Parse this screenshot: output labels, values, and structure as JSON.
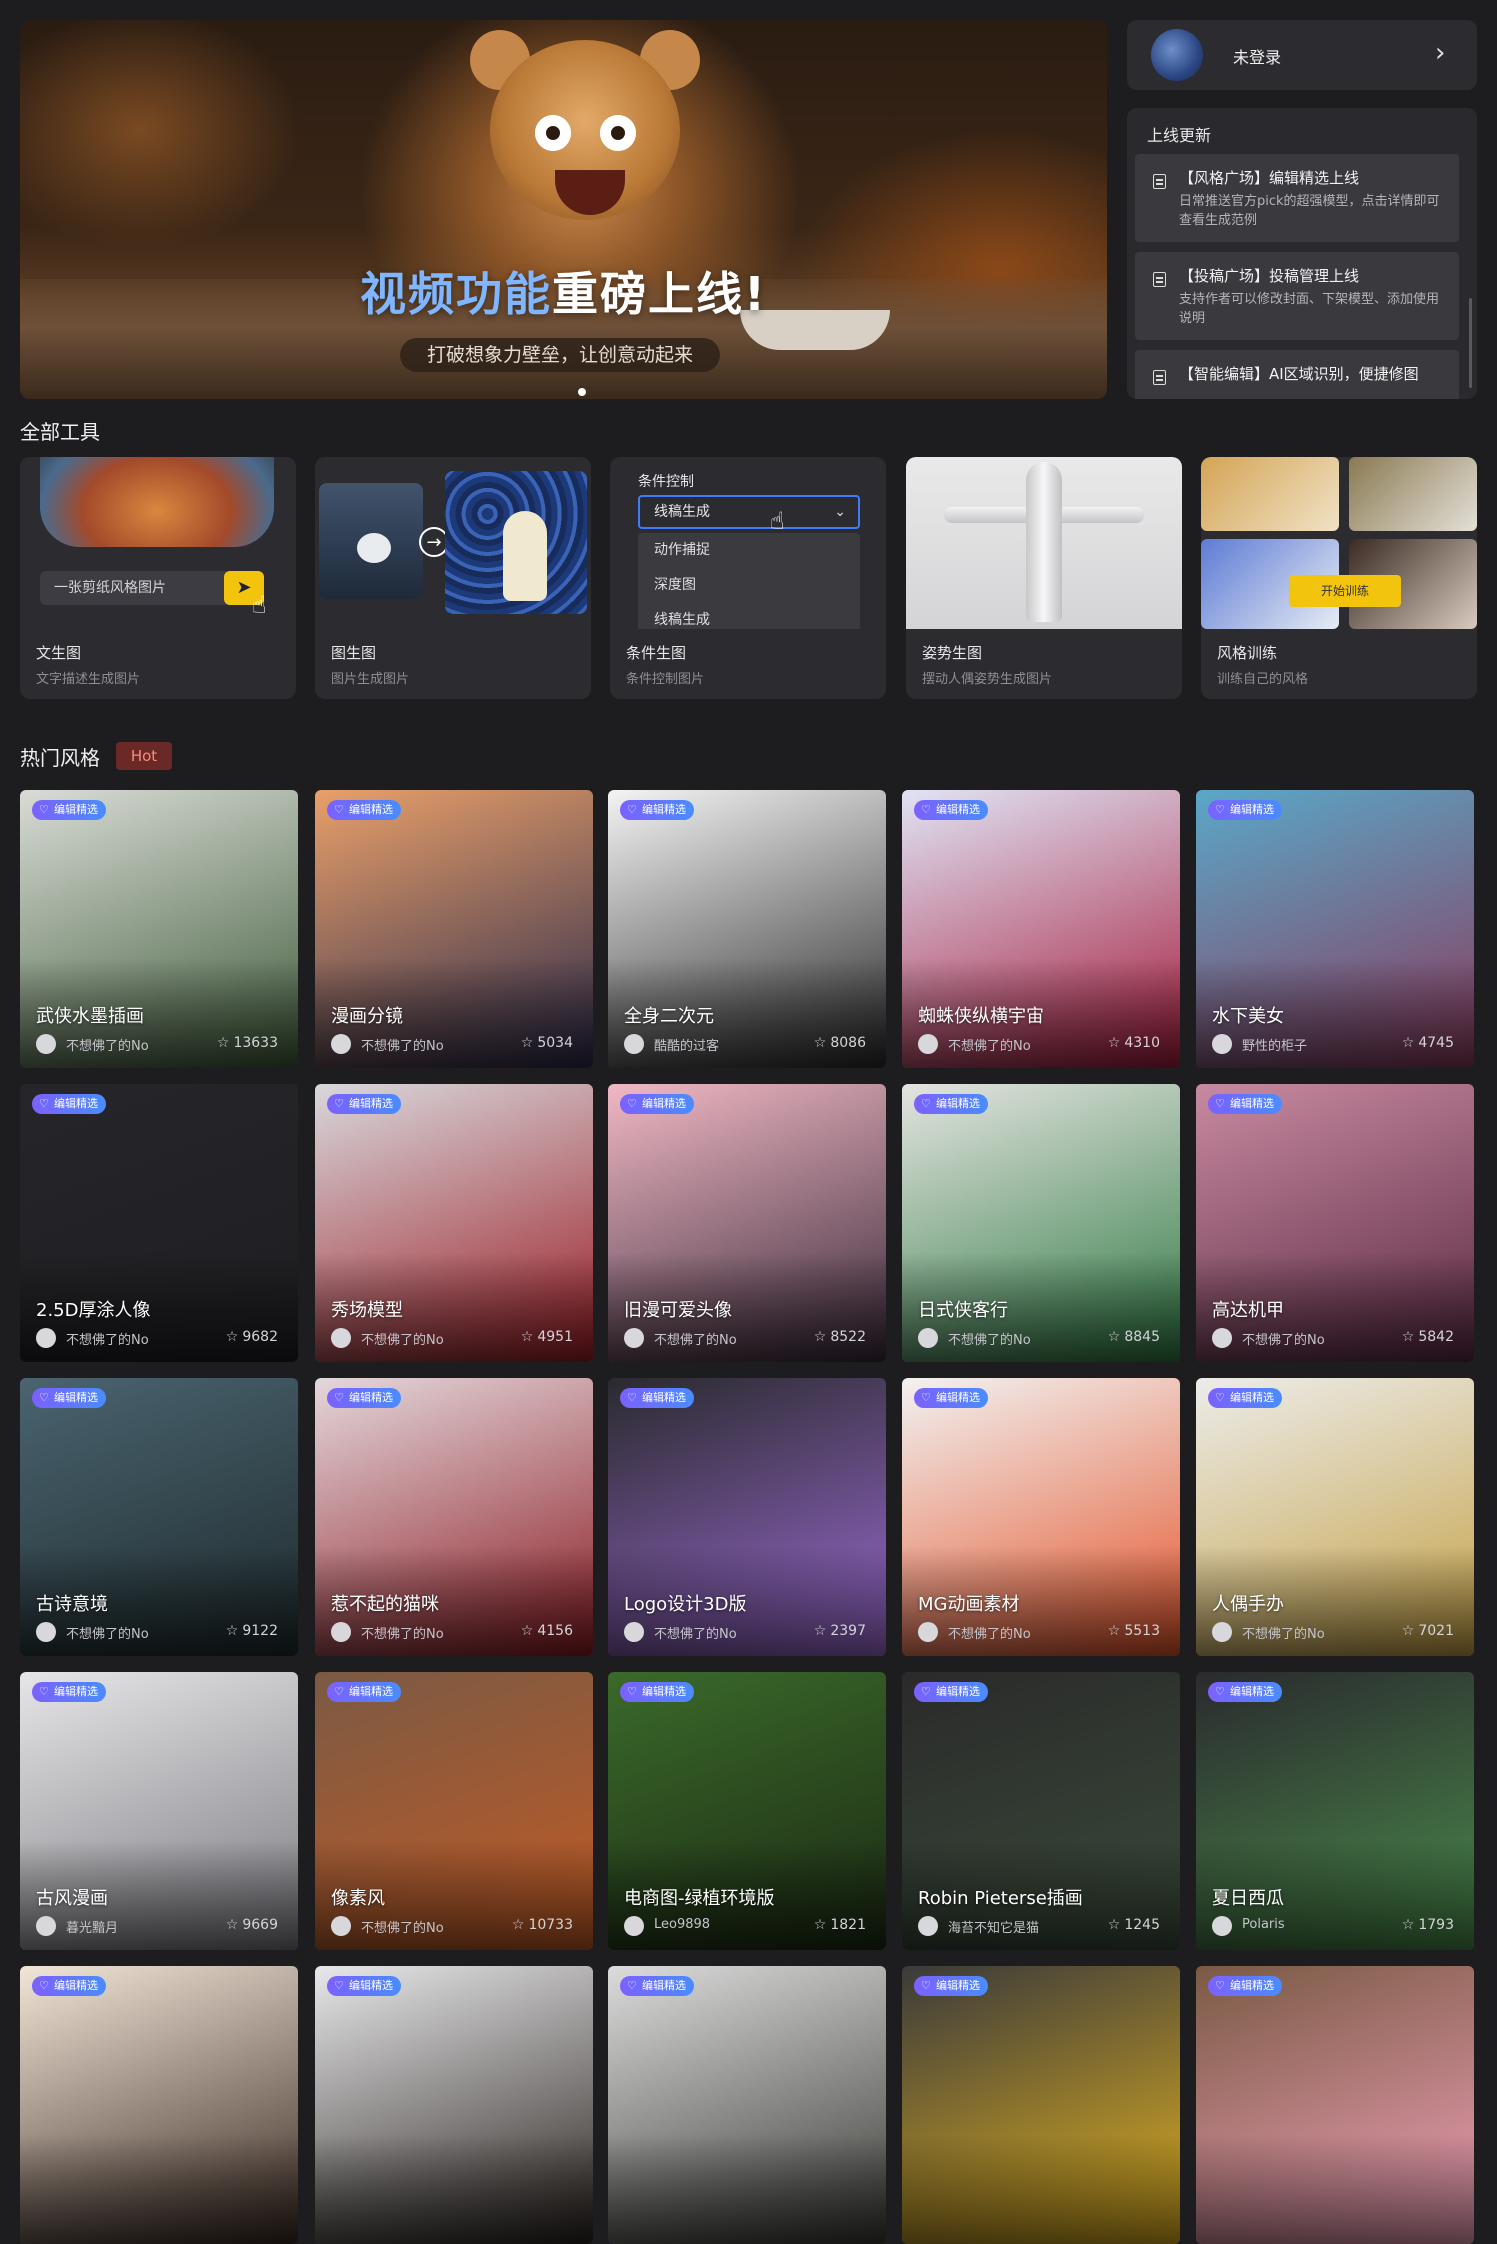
{
  "banner": {
    "headline_colored": "视频功能",
    "headline_rest": "重磅上线!",
    "subtitle": "打破想象力壁垒，让创意动起来"
  },
  "user": {
    "name": "未登录"
  },
  "updates": {
    "title": "上线更新",
    "items": [
      {
        "title": "【风格广场】编辑精选上线",
        "desc": "日常推送官方pick的超强模型，点击详情即可查看生成范例"
      },
      {
        "title": "【投稿广场】投稿管理上线",
        "desc": "支持作者可以修改封面、下架模型、添加使用说明"
      },
      {
        "title": "【智能编辑】AI区域识别，便捷修图",
        "desc": ""
      }
    ]
  },
  "tools_section": {
    "title": "全部工具",
    "tools": [
      {
        "name": "文生图",
        "desc": "文字描述生成图片",
        "prompt": "一张剪纸风格图片"
      },
      {
        "name": "图生图",
        "desc": "图片生成图片"
      },
      {
        "name": "条件生图",
        "desc": "条件控制图片",
        "label": "条件控制",
        "selected": "线稿生成",
        "options": [
          "动作捕捉",
          "深度图",
          "线稿生成"
        ]
      },
      {
        "name": "姿势生图",
        "desc": "摆动人偶姿势生成图片"
      },
      {
        "name": "风格训练",
        "desc": "训练自己的风格",
        "button": "开始训练"
      }
    ]
  },
  "hot_section": {
    "title": "热门风格",
    "badge": "Hot",
    "tag_label": "编辑精选",
    "cards": [
      {
        "title": "武侠水墨插画",
        "author": "不想佛了的No",
        "likes": "13633",
        "c1": "#d9dcd6",
        "c2": "#3f5a3a"
      },
      {
        "title": "漫画分镜",
        "author": "不想佛了的No",
        "likes": "5034",
        "c1": "#e9a06a",
        "c2": "#2c2a4a"
      },
      {
        "title": "全身二次元",
        "author": "酷酷的过客",
        "likes": "8086",
        "c1": "#f4f4f4",
        "c2": "#2a2a2a"
      },
      {
        "title": "蜘蛛侠纵横宇宙",
        "author": "不想佛了的No",
        "likes": "4310",
        "c1": "#e0e4f4",
        "c2": "#a51a3c"
      },
      {
        "title": "水下美女",
        "author": "野性的柜子",
        "likes": "4745",
        "c1": "#5aa8c8",
        "c2": "#8a3a5c"
      },
      {
        "title": "2.5D厚涂人像",
        "author": "不想佛了的No",
        "likes": "9682",
        "c1": "#26262a",
        "c2": "#1e1e22"
      },
      {
        "title": "秀场模型",
        "author": "不想佛了的No",
        "likes": "4951",
        "c1": "#d8d8dc",
        "c2": "#9a1c24"
      },
      {
        "title": "旧漫可爱头像",
        "author": "不想佛了的No",
        "likes": "8522",
        "c1": "#f0b8c4",
        "c2": "#3a2a3a"
      },
      {
        "title": "日式侠客行",
        "author": "不想佛了的No",
        "likes": "8845",
        "c1": "#e4e4e0",
        "c2": "#2f7a44"
      },
      {
        "title": "高达机甲",
        "author": "不想佛了的No",
        "likes": "5842",
        "c1": "#c88aa0",
        "c2": "#5a2a44"
      },
      {
        "title": "古诗意境",
        "author": "不想佛了的No",
        "likes": "9122",
        "c1": "#4a6470",
        "c2": "#1e2a2c"
      },
      {
        "title": "惹不起的猫咪",
        "author": "不想佛了的No",
        "likes": "4156",
        "c1": "#e4d8dc",
        "c2": "#8a1a22"
      },
      {
        "title": "Logo设计3D版",
        "author": "不想佛了的No",
        "likes": "2397",
        "c1": "#2a2a2e",
        "c2": "#9a6ad0"
      },
      {
        "title": "MG动画素材",
        "author": "不想佛了的No",
        "likes": "5513",
        "c1": "#f2f2f2",
        "c2": "#e4542a"
      },
      {
        "title": "人偶手办",
        "author": "不想佛了的No",
        "likes": "7021",
        "c1": "#ececea",
        "c2": "#c4a044"
      },
      {
        "title": "古风漫画",
        "author": "暮光黯月",
        "likes": "9669",
        "c1": "#e6e6e8",
        "c2": "#7a7a80"
      },
      {
        "title": "像素风",
        "author": "不想佛了的No",
        "likes": "10733",
        "c1": "#7a5a44",
        "c2": "#c25a24"
      },
      {
        "title": "电商图-绿植环境版",
        "author": "Leo9898",
        "likes": "1821",
        "c1": "#3a6a2a",
        "c2": "#1c2a14"
      },
      {
        "title": "Robin Pieterse插画",
        "author": "海苔不知它是猫",
        "likes": "1245",
        "c1": "#2a2a2a",
        "c2": "#3a4a3a"
      },
      {
        "title": "夏日西瓜",
        "author": "Polaris",
        "likes": "1793",
        "c1": "#2a2a2e",
        "c2": "#4a8a4a"
      },
      {
        "title": "",
        "author": "",
        "likes": "",
        "c1": "#f2e6d8",
        "c2": "#3a2a22"
      },
      {
        "title": "",
        "author": "",
        "likes": "",
        "c1": "#e8e8ea",
        "c2": "#2a2420"
      },
      {
        "title": "",
        "author": "",
        "likes": "",
        "c1": "#dcdcdc",
        "c2": "#3a3a36"
      },
      {
        "title": "",
        "author": "",
        "likes": "",
        "c1": "#3a3a3a",
        "c2": "#e0b020"
      },
      {
        "title": "",
        "author": "",
        "likes": "",
        "c1": "#7a5a44",
        "c2": "#f0a0b8"
      }
    ]
  }
}
